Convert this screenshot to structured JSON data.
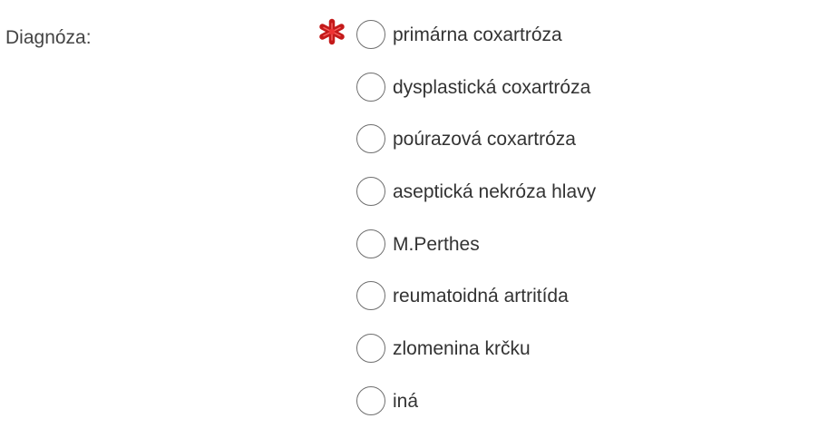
{
  "field": {
    "label": "Diagnóza:",
    "required_icon": "asterisk-required-icon",
    "required_color": "#cc1f1f"
  },
  "options": [
    {
      "label": "primárna coxartróza",
      "selected": false
    },
    {
      "label": "dysplastická coxartróza",
      "selected": false
    },
    {
      "label": "poúrazová coxartróza",
      "selected": false
    },
    {
      "label": "aseptická nekróza hlavy",
      "selected": false
    },
    {
      "label": "M.Perthes",
      "selected": false
    },
    {
      "label": "reumatoidná artritída",
      "selected": false
    },
    {
      "label": "zlomenina krčku",
      "selected": false
    },
    {
      "label": "iná",
      "selected": false
    }
  ]
}
